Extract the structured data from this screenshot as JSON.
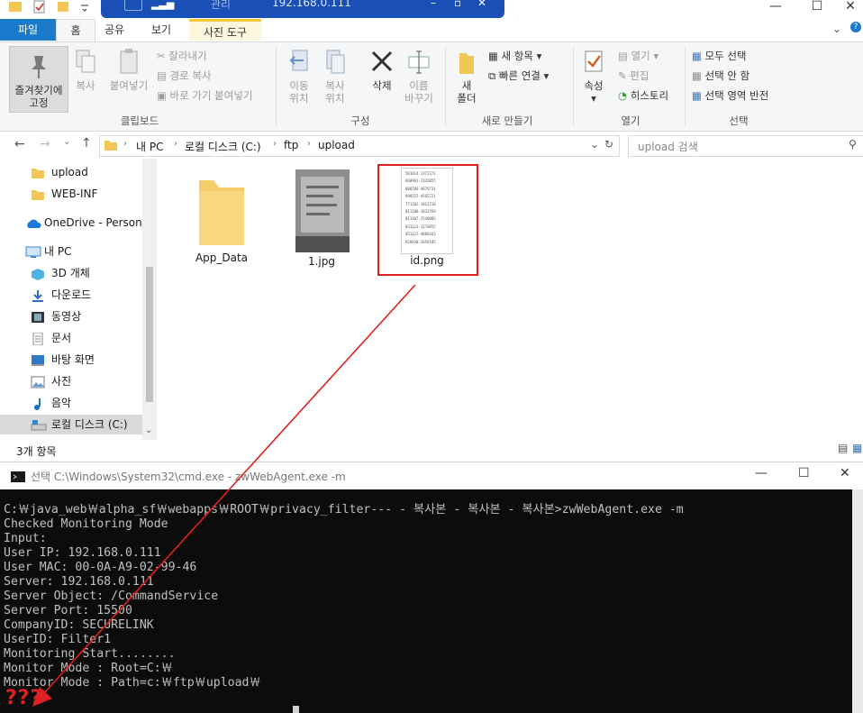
{
  "remote": {
    "ip": "192.168.0.111",
    "manage_tab": "관리"
  },
  "ribbon_tabs": [
    "파일",
    "홈",
    "공유",
    "보기",
    "사진 도구"
  ],
  "ribbon": {
    "pin": "즐겨찾기에\n고정",
    "copy": "복사",
    "paste": "붙여넣기",
    "cut": "잘라내기",
    "copy_path": "경로 복사",
    "paste_shortcut": "바로 가기 붙여넣기",
    "clipboard_group": "클립보드",
    "move_to": "이동\n위치",
    "copy_to": "복사\n위치",
    "delete": "삭제",
    "rename": "이름\n바꾸기",
    "organize_group": "구성",
    "new_folder": "새\n폴더",
    "new_item": "새 항목",
    "easy_access": "빠른 연결",
    "new_group": "새로 만들기",
    "properties": "속성",
    "open": "열기",
    "edit": "편집",
    "history": "히스토리",
    "open_group": "열기",
    "select_all": "모두 선택",
    "select_none": "선택 안 함",
    "invert_selection": "선택 영역 반전",
    "select_group": "선택"
  },
  "address": {
    "crumbs": [
      "내 PC",
      "로컬 디스크 (C:)",
      "ftp",
      "upload"
    ],
    "search_placeholder": "upload 검색"
  },
  "nav": {
    "items": [
      {
        "label": "upload",
        "icon": "folder-icon"
      },
      {
        "label": "WEB-INF",
        "icon": "folder-icon"
      },
      {
        "label": "OneDrive - Personal",
        "icon": "cloud-icon"
      },
      {
        "label": "내 PC",
        "icon": "pc-icon"
      },
      {
        "label": "3D 개체",
        "icon": "cube-icon"
      },
      {
        "label": "다운로드",
        "icon": "download-icon"
      },
      {
        "label": "동영상",
        "icon": "video-icon"
      },
      {
        "label": "문서",
        "icon": "document-icon"
      },
      {
        "label": "바탕 화면",
        "icon": "desktop-icon"
      },
      {
        "label": "사진",
        "icon": "pictures-icon"
      },
      {
        "label": "음악",
        "icon": "music-icon"
      },
      {
        "label": "로컬 디스크 (C:)",
        "icon": "drive-icon"
      }
    ]
  },
  "files": [
    {
      "name": "App_Data",
      "kind": "folder"
    },
    {
      "name": "1.jpg",
      "kind": "photo"
    },
    {
      "name": "id.png",
      "kind": "id-list"
    }
  ],
  "id_thumbnail_lines": [
    "581014-1372371",
    "860901-2326855",
    "080706-4679731",
    "090715-4565721",
    "771202-1812710",
    "011100-1832769",
    "011107-2540085",
    "031113-3170855",
    "051117-4606443",
    "820930-2656185"
  ],
  "status": {
    "count": "3개 항목"
  },
  "cmd": {
    "title": "선택 C:\\Windows\\System32\\cmd.exe - zwWebAgent.exe  -m",
    "lines": [
      "C:￦java_web￦alpha_sf￦webapps￦ROOT￦privacy_filter--- - 복사본 - 복사본 - 복사본>zwWebAgent.exe -m",
      "Checked Monitoring Mode",
      "Input:",
      "User IP: 192.168.0.111",
      "User MAC: 00-0A-A9-02-99-46",
      "Server: 192.168.0.111",
      "Server Object: /CommandService",
      "Server Port: 15500",
      "CompanyID: SECURELINK",
      "UserID: Filter1",
      "Monitoring Start........",
      "Monitor Mode : Root=C:￦",
      "Monitor Mode : Path=c:￦ftp￦upload￦"
    ],
    "annotation": "???"
  },
  "colors": {
    "annotation": "#e02020",
    "accent": "#1979ca",
    "banner": "#1a4fb8"
  }
}
